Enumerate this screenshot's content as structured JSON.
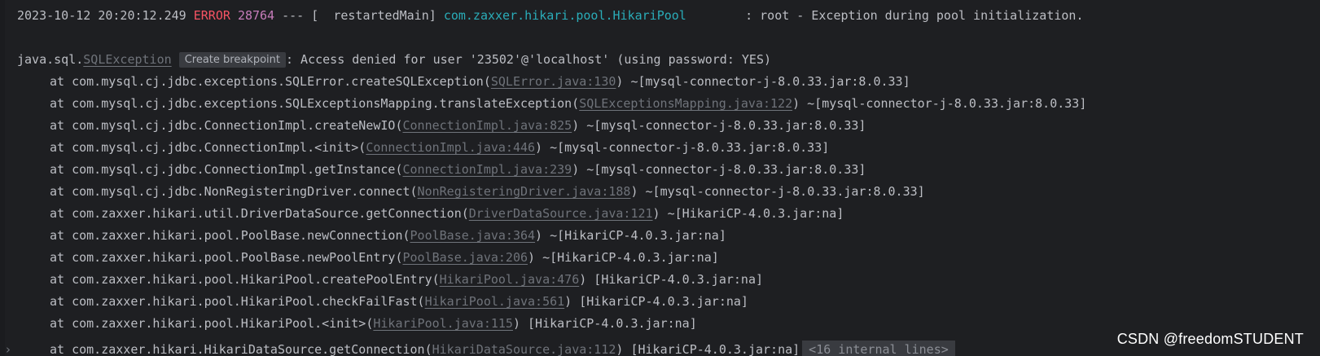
{
  "header": {
    "timestamp": "2023-10-12 20:20:12.249",
    "level": "ERROR",
    "pid": "28764",
    "separator": "---",
    "thread": "[  restartedMain]",
    "logger": "com.zaxxer.hikari.pool.HikariPool",
    "message": ": root - Exception during pool initialization."
  },
  "exception": {
    "prefix": "java.sql.",
    "class_link": "SQLException",
    "breakpoint_label": "Create breakpoint",
    "message": ": Access denied for user '23502'@'localhost' (using password: YES)"
  },
  "stack": [
    {
      "method": "at com.mysql.cj.jdbc.exceptions.SQLError.createSQLException(",
      "link": "SQLError.java:130",
      "suffix": ") ~[mysql-connector-j-8.0.33.jar:8.0.33]"
    },
    {
      "method": "at com.mysql.cj.jdbc.exceptions.SQLExceptionsMapping.translateException(",
      "link": "SQLExceptionsMapping.java:122",
      "suffix": ") ~[mysql-connector-j-8.0.33.jar:8.0.33]"
    },
    {
      "method": "at com.mysql.cj.jdbc.ConnectionImpl.createNewIO(",
      "link": "ConnectionImpl.java:825",
      "suffix": ") ~[mysql-connector-j-8.0.33.jar:8.0.33]"
    },
    {
      "method": "at com.mysql.cj.jdbc.ConnectionImpl.<init>(",
      "link": "ConnectionImpl.java:446",
      "suffix": ") ~[mysql-connector-j-8.0.33.jar:8.0.33]"
    },
    {
      "method": "at com.mysql.cj.jdbc.ConnectionImpl.getInstance(",
      "link": "ConnectionImpl.java:239",
      "suffix": ") ~[mysql-connector-j-8.0.33.jar:8.0.33]"
    },
    {
      "method": "at com.mysql.cj.jdbc.NonRegisteringDriver.connect(",
      "link": "NonRegisteringDriver.java:188",
      "suffix": ") ~[mysql-connector-j-8.0.33.jar:8.0.33]"
    },
    {
      "method": "at com.zaxxer.hikari.util.DriverDataSource.getConnection(",
      "link": "DriverDataSource.java:121",
      "suffix": ") ~[HikariCP-4.0.3.jar:na]"
    },
    {
      "method": "at com.zaxxer.hikari.pool.PoolBase.newConnection(",
      "link": "PoolBase.java:364",
      "suffix": ") ~[HikariCP-4.0.3.jar:na]"
    },
    {
      "method": "at com.zaxxer.hikari.pool.PoolBase.newPoolEntry(",
      "link": "PoolBase.java:206",
      "suffix": ") ~[HikariCP-4.0.3.jar:na]"
    },
    {
      "method": "at com.zaxxer.hikari.pool.HikariPool.createPoolEntry(",
      "link": "HikariPool.java:476",
      "suffix": ") [HikariCP-4.0.3.jar:na]"
    },
    {
      "method": "at com.zaxxer.hikari.pool.HikariPool.checkFailFast(",
      "link": "HikariPool.java:561",
      "suffix": ") [HikariCP-4.0.3.jar:na]"
    },
    {
      "method": "at com.zaxxer.hikari.pool.HikariPool.<init>(",
      "link": "HikariPool.java:115",
      "suffix": ") [HikariCP-4.0.3.jar:na]"
    },
    {
      "method": "at com.zaxxer.hikari.HikariDataSource.getConnection(",
      "link": "HikariDataSource.java:112",
      "suffix": ") [HikariCP-4.0.3.jar:na]",
      "internal": "<16 internal lines>"
    }
  ],
  "fold_icon": "chevron-right-icon",
  "watermark": "CSDN @freedomSTUDENT",
  "colors": {
    "background": "#1e1f22",
    "text": "#bcbec4",
    "error": "#f75464",
    "pid": "#c77dbb",
    "logger": "#2aacb8",
    "link": "#6f737a"
  }
}
